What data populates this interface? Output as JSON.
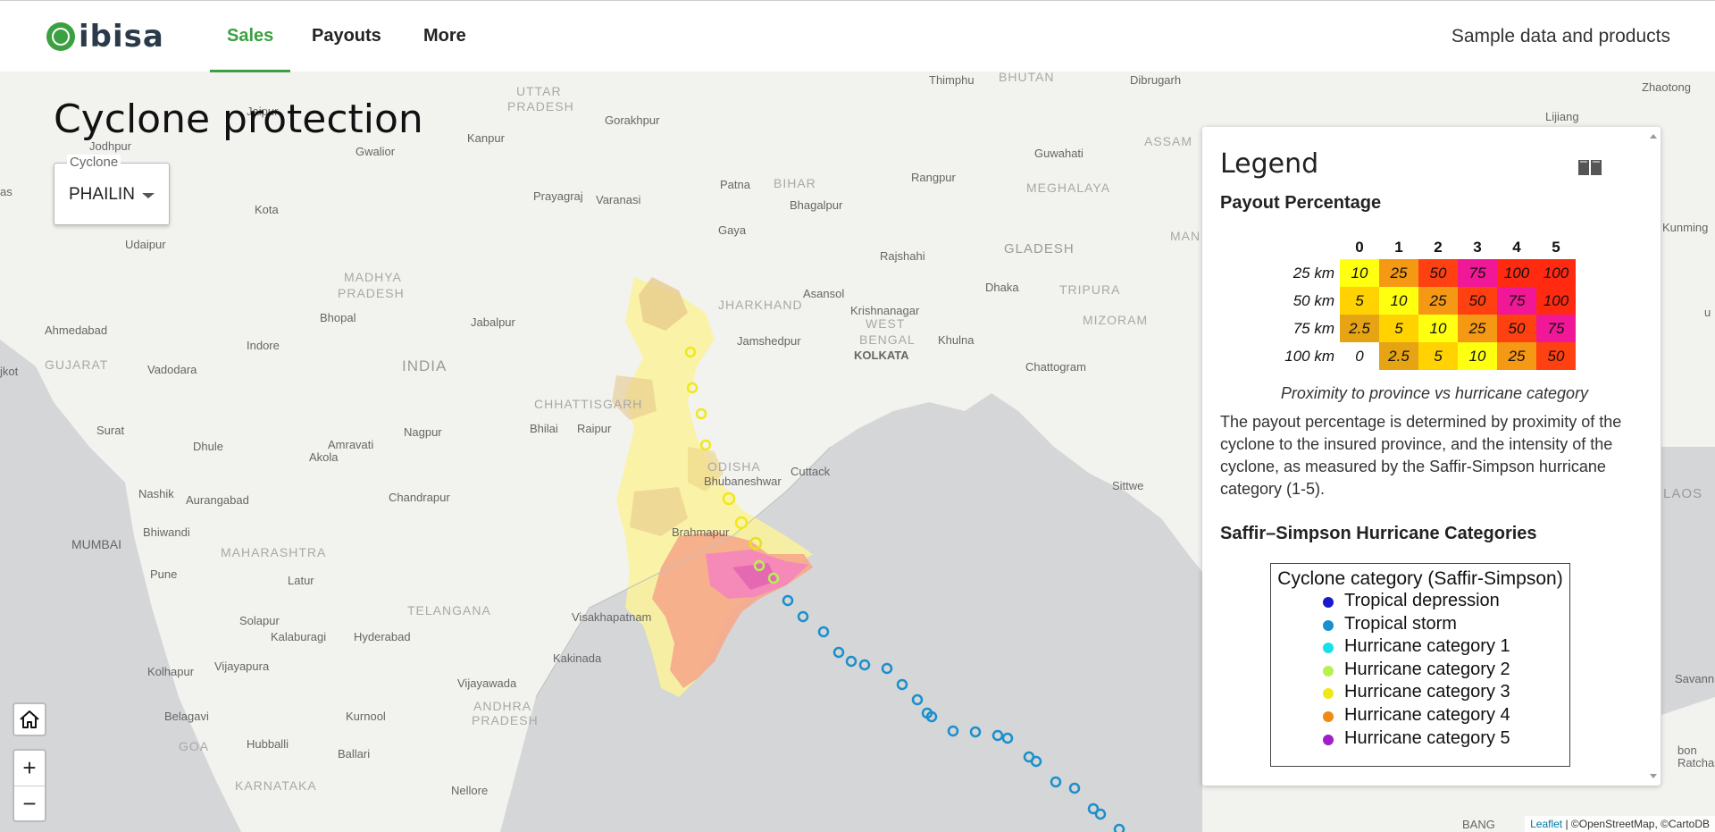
{
  "header": {
    "logo_text": "ibisa",
    "tabs": [
      {
        "label": "Sales",
        "active": true
      },
      {
        "label": "Payouts",
        "active": false
      },
      {
        "label": "More",
        "active": false
      }
    ],
    "sample_link": "Sample data and products"
  },
  "page_title": "Cyclone protection",
  "cyclone_select": {
    "label": "Cyclone",
    "value": "PHAILIN"
  },
  "map_controls": {
    "home": "⌂",
    "zoom_in": "+",
    "zoom_out": "−"
  },
  "attribution": {
    "leaflet": "Leaflet",
    "rest": " | ©OpenStreetMap, ©CartoDB"
  },
  "map_labels": [
    {
      "text": "UTTAR",
      "cls": "state"
    },
    {
      "text": "PRADESH",
      "cls": "state"
    },
    {
      "text": "Thimphu",
      "cls": "city"
    },
    {
      "text": "BHUTAN",
      "cls": "state"
    },
    {
      "text": "Dibrugarh",
      "cls": "city"
    },
    {
      "text": "Zhaotong",
      "cls": "city"
    },
    {
      "text": "Jaipur",
      "cls": "city"
    },
    {
      "text": "Gorakhpur",
      "cls": "city"
    },
    {
      "text": "Kanpur",
      "cls": "city"
    },
    {
      "text": "Lijiang",
      "cls": "city"
    },
    {
      "text": "ASSAM",
      "cls": "state"
    },
    {
      "text": "Jodhpur",
      "cls": "city"
    },
    {
      "text": "Gwalior",
      "cls": "city"
    },
    {
      "text": "Guwahati",
      "cls": "city"
    },
    {
      "text": "Patna",
      "cls": "city"
    },
    {
      "text": "BIHAR",
      "cls": "state"
    },
    {
      "text": "Rangpur",
      "cls": "city"
    },
    {
      "text": "Prayagraj",
      "cls": "city"
    },
    {
      "text": "Varanasi",
      "cls": "city"
    },
    {
      "text": "MEGHALAYA",
      "cls": "state"
    },
    {
      "text": "Bhagalpur",
      "cls": "city"
    },
    {
      "text": "Kota",
      "cls": "city"
    },
    {
      "text": "Gaya",
      "cls": "city"
    },
    {
      "text": "MAN",
      "cls": "state"
    },
    {
      "text": "Kunming",
      "cls": "city"
    },
    {
      "text": "Udaipur",
      "cls": "city"
    },
    {
      "text": "GLADESH",
      "cls": "big"
    },
    {
      "text": "Rajshahi",
      "cls": "city"
    },
    {
      "text": "MADHYA",
      "cls": "state"
    },
    {
      "text": "PRADESH",
      "cls": "state"
    },
    {
      "text": "Dhaka",
      "cls": "city"
    },
    {
      "text": "TRIPURA",
      "cls": "state"
    },
    {
      "text": "JHARKHAND",
      "cls": "state"
    },
    {
      "text": "Asansol",
      "cls": "city"
    },
    {
      "text": "Krishnanagar",
      "cls": "city"
    },
    {
      "text": "Ahmedabad",
      "cls": "city"
    },
    {
      "text": "Bhopal",
      "cls": "city"
    },
    {
      "text": "Jabalpur",
      "cls": "city"
    },
    {
      "text": "WEST",
      "cls": "state"
    },
    {
      "text": "BENGAL",
      "cls": "state"
    },
    {
      "text": "Khulna",
      "cls": "city"
    },
    {
      "text": "MIZORAM",
      "cls": "state"
    },
    {
      "text": "Indore",
      "cls": "city"
    },
    {
      "text": "Jamshedpur",
      "cls": "city"
    },
    {
      "text": "KOLKATA",
      "cls": "city"
    },
    {
      "text": "GUJARAT",
      "cls": "state"
    },
    {
      "text": "Vadodara",
      "cls": "city"
    },
    {
      "text": "INDIA",
      "cls": "big"
    },
    {
      "text": "Chattogram",
      "cls": "city"
    },
    {
      "text": "CHHATTISGARH",
      "cls": "state"
    },
    {
      "text": "Surat",
      "cls": "city"
    },
    {
      "text": "Bhilai",
      "cls": "city"
    },
    {
      "text": "Raipur",
      "cls": "city"
    },
    {
      "text": "Nagpur",
      "cls": "city"
    },
    {
      "text": "Dhule",
      "cls": "city"
    },
    {
      "text": "Amravati",
      "cls": "city"
    },
    {
      "text": "Akola",
      "cls": "city"
    },
    {
      "text": "ODISHA",
      "cls": "state"
    },
    {
      "text": "Cuttack",
      "cls": "city"
    },
    {
      "text": "Bhubaneshwar",
      "cls": "city"
    },
    {
      "text": "Sittwe",
      "cls": "city"
    },
    {
      "text": "LAOS",
      "cls": "big"
    },
    {
      "text": "Nashik",
      "cls": "city"
    },
    {
      "text": "Aurangabad",
      "cls": "city"
    },
    {
      "text": "Chandrapur",
      "cls": "city"
    },
    {
      "text": "MUMBAI",
      "cls": "city"
    },
    {
      "text": "Bhiwandi",
      "cls": "city"
    },
    {
      "text": "Brahmapur",
      "cls": "city"
    },
    {
      "text": "MAHARASHTRA",
      "cls": "state"
    },
    {
      "text": "Pune",
      "cls": "city"
    },
    {
      "text": "Latur",
      "cls": "city"
    },
    {
      "text": "TELANGANA",
      "cls": "state"
    },
    {
      "text": "Visakhapatnam",
      "cls": "city"
    },
    {
      "text": "Solapur",
      "cls": "city"
    },
    {
      "text": "Kalaburagi",
      "cls": "city"
    },
    {
      "text": "Hyderabad",
      "cls": "city"
    },
    {
      "text": "Kolhapur",
      "cls": "city"
    },
    {
      "text": "Vijayapura",
      "cls": "city"
    },
    {
      "text": "Kakinada",
      "cls": "city"
    },
    {
      "text": "Savann",
      "cls": "city"
    },
    {
      "text": "Vijayawada",
      "cls": "city"
    },
    {
      "text": "ANDHRA",
      "cls": "state"
    },
    {
      "text": "PRADESH",
      "cls": "state"
    },
    {
      "text": "Belagavi",
      "cls": "city"
    },
    {
      "text": "Kurnool",
      "cls": "city"
    },
    {
      "text": "GOA",
      "cls": "state"
    },
    {
      "text": "Hubballi",
      "cls": "city"
    },
    {
      "text": "Ballari",
      "cls": "city"
    },
    {
      "text": "bon",
      "cls": "city"
    },
    {
      "text": "Ratchasi",
      "cls": "city"
    },
    {
      "text": "KARNATAKA",
      "cls": "state"
    },
    {
      "text": "Nellore",
      "cls": "city"
    },
    {
      "text": "BANG",
      "cls": "city"
    },
    {
      "text": "Jodhpur",
      "cls": "city"
    },
    {
      "text": "jkot",
      "cls": "city"
    },
    {
      "text": "as",
      "cls": "city"
    },
    {
      "text": "u",
      "cls": "city"
    }
  ],
  "legend": {
    "title": "Legend",
    "payout_title": "Payout Percentage",
    "payout_columns": [
      "0",
      "1",
      "2",
      "3",
      "4",
      "5"
    ],
    "payout_rows": [
      {
        "label": "25 km",
        "values": [
          "10",
          "25",
          "50",
          "75",
          "100",
          "100"
        ]
      },
      {
        "label": "50 km",
        "values": [
          "5",
          "10",
          "25",
          "50",
          "75",
          "100"
        ]
      },
      {
        "label": "75 km",
        "values": [
          "2.5",
          "5",
          "10",
          "25",
          "50",
          "75"
        ]
      },
      {
        "label": "100 km",
        "values": [
          "0",
          "2.5",
          "5",
          "10",
          "25",
          "50"
        ]
      }
    ],
    "payout_colors": {
      "0": "#ffffff",
      "2.5": "#e6a414",
      "5": "#ffd200",
      "10": "#ffff10",
      "25": "#f59814",
      "50": "#ff4010",
      "75": "#f01896",
      "100": "#ff2a10"
    },
    "caption": "Proximity to province vs hurricane category",
    "description": "The payout percentage is determined by proximity of the cyclone to the insured province, and the intensity of the cyclone, as measured by the Saffir-Simpson hurricane category (1-5).",
    "categories_title": "Saffir–Simpson Hurricane Categories",
    "categories_box_title": "Cyclone category (Saffir-Simpson)",
    "categories": [
      {
        "label": "Tropical depression",
        "color": "#1a1acc"
      },
      {
        "label": "Tropical storm",
        "color": "#1a8fcc"
      },
      {
        "label": "Hurricane category 1",
        "color": "#18e0e8"
      },
      {
        "label": "Hurricane category 2",
        "color": "#b8f050"
      },
      {
        "label": "Hurricane category 3",
        "color": "#f0e818"
      },
      {
        "label": "Hurricane category 4",
        "color": "#f08a10"
      },
      {
        "label": "Hurricane category 5",
        "color": "#a020c8"
      }
    ]
  }
}
